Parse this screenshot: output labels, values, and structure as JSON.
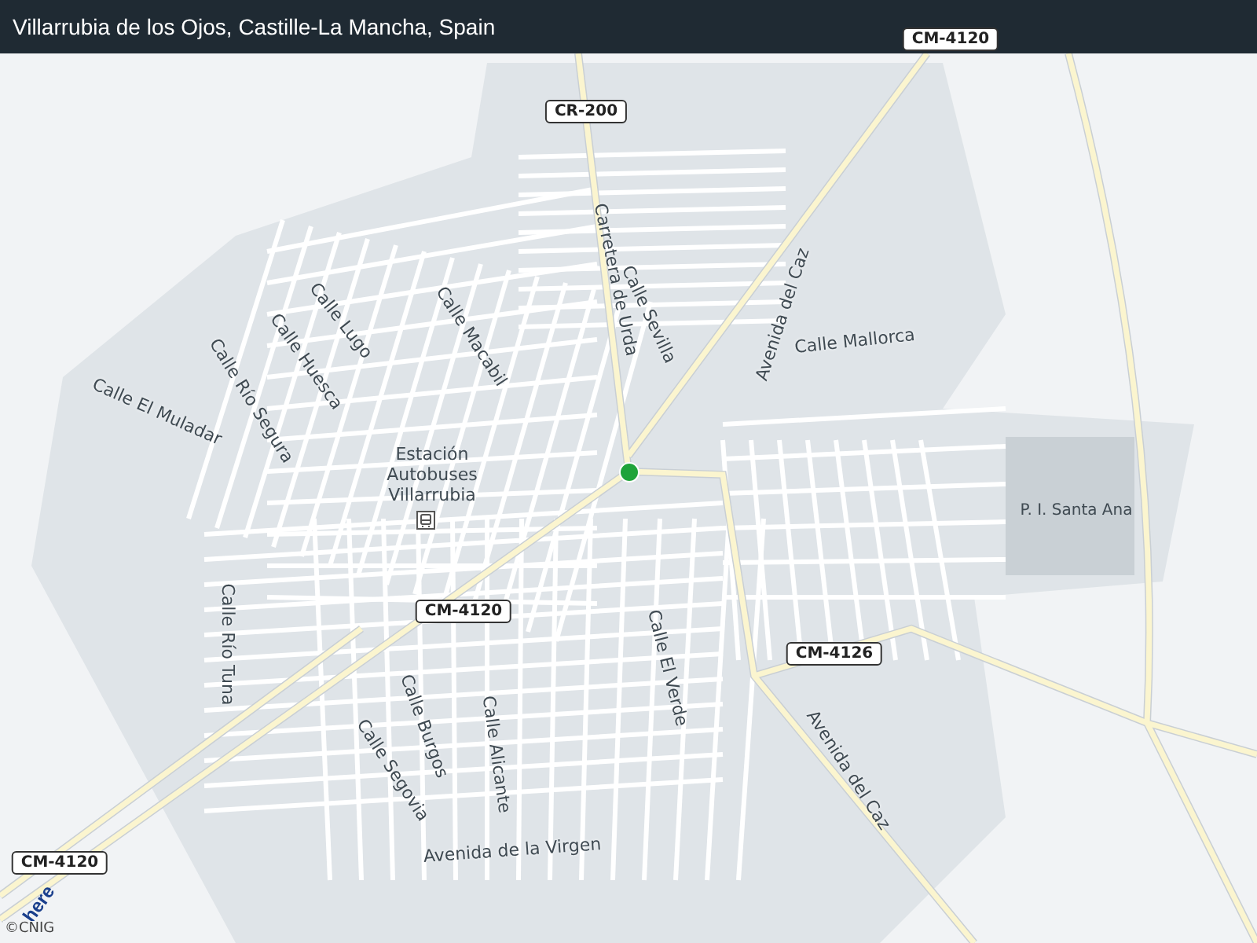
{
  "header": {
    "title": "Villarrubia de los Ojos, Castille-La Mancha, Spain"
  },
  "map": {
    "road_numbers": [
      "CM-4120",
      "CR-200",
      "CM-4120",
      "CM-4126",
      "CM-4120"
    ],
    "street_labels": [
      "Carretera de Urda",
      "Calle Sevilla",
      "Avenida del Caz",
      "Calle Mallorca",
      "Calle Lugo",
      "Calle Macabil",
      "Calle Huesca",
      "Calle Río Segura",
      "Calle El Muladar",
      "Calle Río Tuna",
      "Calle El Verde",
      "Avenida del Caz",
      "Calle Burgos",
      "Calle Segovia",
      "Calle Alicante",
      "Avenida de la Virgen"
    ],
    "poi": {
      "label": "Estación Autobuses Villarrubia"
    },
    "area_label": "P. I. Santa Ana"
  },
  "attribution": {
    "logo": "here",
    "copyright": "©CNIG"
  }
}
